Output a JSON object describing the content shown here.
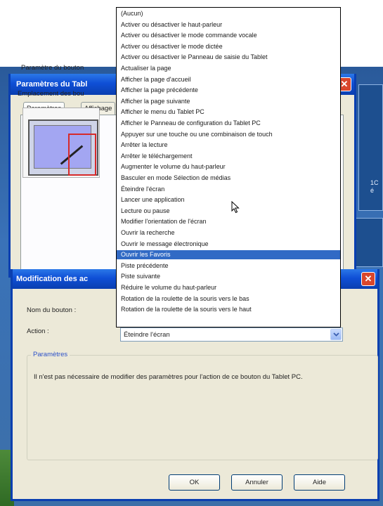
{
  "tablet_window": {
    "title": "Paramètres du Tabl",
    "close": "✕",
    "tabs": [
      "Paramètres",
      "Affichage"
    ],
    "parameter_label": "Paramètre du bouton",
    "location_label": "Emplacement des bou"
  },
  "desktop": {
    "text_lines": [
      "1C",
      "é"
    ]
  },
  "dialog": {
    "title": "Modification des ac",
    "close": "✕",
    "button_name_label": "Nom du bouton :",
    "action_label": "Action :",
    "action_value": "Éteindre l'écran",
    "parameters_legend": "Paramètres",
    "parameters_text": "Il n'est pas nécessaire de modifier des paramètres pour l'action de ce bouton du Tablet PC.",
    "ok_label": "OK",
    "cancel_label": "Annuler",
    "help_label": "Aide"
  },
  "dropdown": {
    "selected_index": 22,
    "items": [
      "(Aucun)",
      "Activer ou désactiver le haut-parleur",
      "Activer ou désactiver le mode commande vocale",
      "Activer ou désactiver le mode dictée",
      "Activer ou désactiver le Panneau de saisie du Tablet",
      "Actualiser la page",
      "Afficher la page d'accueil",
      "Afficher la page précédente",
      "Afficher la page suivante",
      "Afficher le menu du Tablet PC",
      "Afficher le Panneau de configuration du Tablet PC",
      "Appuyer sur une touche ou une combinaison de touch",
      "Arrêter la lecture",
      "Arrêter le téléchargement",
      "Augmenter le volume du haut-parleur",
      "Basculer en mode Sélection de médias",
      "Éteindre l'écran",
      "Lancer une application",
      "Lecture ou pause",
      "Modifier l'orientation de l'écran",
      "Ouvrir la recherche",
      "Ouvrir le message électronique",
      "Ouvrir les Favoris",
      "Piste précédente",
      "Piste suivante",
      "Réduire le volume du haut-parleur",
      "Rotation de la roulette de la souris vers le bas",
      "Rotation de la roulette de la souris vers le haut"
    ]
  },
  "colors": {
    "title_bar": "#0f4fd6",
    "selection": "#316ac5",
    "close_button": "#d9462c",
    "highlight_box": "#d62a2a"
  }
}
